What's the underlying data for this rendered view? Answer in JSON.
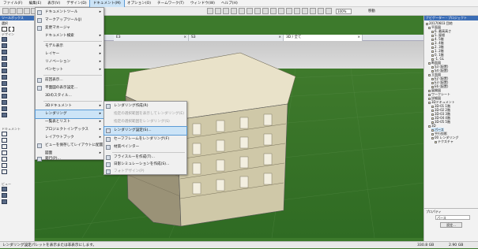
{
  "menubar": [
    "ファイル(F)",
    "編集(E)",
    "表示(V)",
    "デザイン(D)",
    "ドキュメント(M)",
    "オプション(O)",
    "チームワーク(T)",
    "ウィンドウ(W)",
    "ヘルプ(H)"
  ],
  "toolbar": {
    "zoom": "100%",
    "action": "移動"
  },
  "toolbox": {
    "title": "ツールボックス",
    "select": "選択",
    "sections": [
      "デザイン",
      "ドキュメント",
      "ビュー"
    ]
  },
  "tabs": [
    {
      "label": "E3",
      "close": "×"
    },
    {
      "label": "S3",
      "close": "×"
    },
    {
      "label": "3D / 全て",
      "close": "×"
    }
  ],
  "doc_menu": [
    "ドキュメントツール",
    "マークアップツール(J)",
    "変更マネージャ",
    "ドキュメント検索",
    "モデル表示",
    "レイヤー",
    "リノベーション",
    "ペンセット",
    "前回表示...",
    "平面図の表示設定...",
    "3Dのスタイル...",
    "3Dドキュメント",
    "レンダリング",
    "一覧表とリスト",
    "プロジェクトインデックス",
    "レイアウトブック",
    "ビューを保存してレイアウトに配置  Alt+F7",
    "図面",
    "発行(P)..."
  ],
  "render_menu": [
    "レンダリング作成(R)",
    "指定の選択範囲を表示してレンダリング(E)",
    "指定の選択範囲をレンダリング(S)",
    "レンダリング設定(S)...",
    "セーフフレームをレンダリング(F)",
    "材質ペインター",
    "フライスルーを作成(T)...",
    "日影シミュレーションを作成(S)...",
    "フォトデザイン(P)"
  ],
  "navigator": {
    "title": "ナビゲーター - プロジェクト",
    "items": [
      "20170603 団地",
      "平面図",
      "6. 最高高さ",
      "5. 屋根",
      "4. 5階",
      "3. 4階",
      "2. 3階",
      "1. 2階",
      "0. 1階",
      "-1. GL",
      "断面図",
      "S3 (配置)",
      "S4 (配置)",
      "立面図",
      "E2 (配置)",
      "E3 (配置)",
      "E6 (配置)",
      "展開図",
      "ワークシート",
      "詳細図",
      "3Dドキュメント",
      "3D-01 1階",
      "3D-02 2階",
      "3D-03 3階",
      "3D-04 4階",
      "3D-05 5階",
      "3D",
      "パース",
      "平行投影",
      "00 レンダリング",
      "テクスチャ"
    ],
    "properties_label": "プロパティ",
    "perspective": "パース",
    "settings_button": "設定..."
  },
  "status": {
    "hint": "レンダリング設定パレットを表示または非表示にします。",
    "disk": "330.8 GB",
    "ram": "2.90 GB"
  },
  "colors": {
    "accent": "#3b6db5",
    "ground": "#3d7a2c",
    "highlight": "#cce4f7"
  }
}
